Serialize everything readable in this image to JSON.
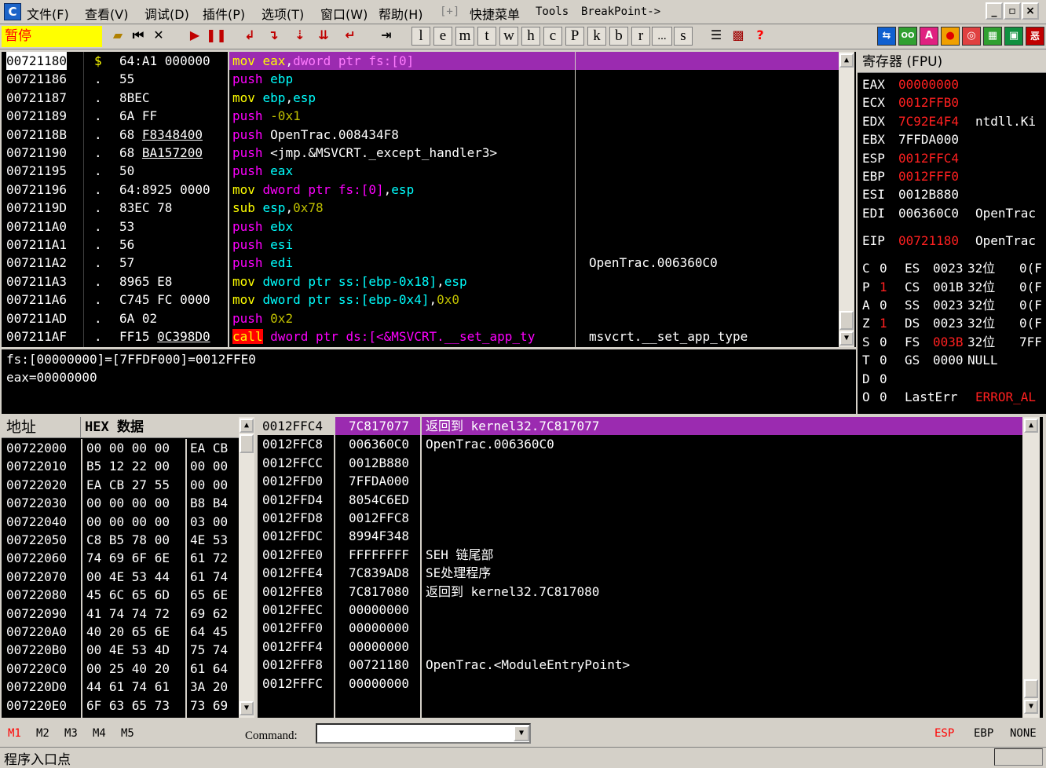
{
  "menubar": {
    "app_icon": "C",
    "items": [
      "文件(F)",
      "查看(V)",
      "调试(D)",
      "插件(P)",
      "选项(T)",
      "窗口(W)",
      "帮助(H)",
      "[+]",
      "快捷菜单",
      "Tools",
      "BreakPoint->"
    ],
    "window_buttons": [
      "_",
      "▫",
      "×"
    ]
  },
  "toolbar": {
    "status": "暂停",
    "letters": [
      "l",
      "e",
      "m",
      "t",
      "w",
      "h",
      "c",
      "P",
      "k",
      "b",
      "r",
      "...",
      "s"
    ],
    "help": "?",
    "right_icons": [
      "⇆",
      "OO",
      "A",
      "●",
      "◎",
      "▦",
      "▣",
      "恶"
    ]
  },
  "cpu": {
    "rows": [
      {
        "addr": "00721180",
        "mark": "$",
        "hex": "64:A1 000000",
        "dis": [
          [
            "mnem-mg",
            "mov "
          ],
          [
            "cy",
            "eax"
          ],
          [
            "wh",
            ","
          ],
          [
            "mg",
            "dword ptr fs:[0]"
          ]
        ],
        "comment": ""
      },
      {
        "addr": "00721186",
        "mark": ".",
        "hex": "55",
        "dis": [
          [
            "mg",
            "push "
          ],
          [
            "cy",
            "ebp"
          ]
        ],
        "comment": ""
      },
      {
        "addr": "00721187",
        "mark": ".",
        "hex": "8BEC",
        "dis": [
          [
            "yl",
            "mov "
          ],
          [
            "cy",
            "ebp"
          ],
          [
            "wh",
            ","
          ],
          [
            "cy",
            "esp"
          ]
        ],
        "comment": ""
      },
      {
        "addr": "00721189",
        "mark": ".",
        "hex": "6A FF",
        "dis": [
          [
            "mg",
            "push "
          ],
          [
            "ol",
            "-0x1"
          ]
        ],
        "comment": ""
      },
      {
        "addr": "0072118B",
        "mark": ".",
        "hex": "68 F8348400",
        "dis": [
          [
            "mg",
            "push "
          ],
          [
            "wh",
            "OpenTrac.008434F8"
          ]
        ],
        "comment": ""
      },
      {
        "addr": "00721190",
        "mark": ".",
        "hex": "68 BA157200",
        "dis": [
          [
            "mg",
            "push "
          ],
          [
            "wh",
            "<jmp.&MSVCRT._except_handler3>"
          ]
        ],
        "comment": ""
      },
      {
        "addr": "00721195",
        "mark": ".",
        "hex": "50",
        "dis": [
          [
            "mg",
            "push "
          ],
          [
            "cy",
            "eax"
          ]
        ],
        "comment": ""
      },
      {
        "addr": "00721196",
        "mark": ".",
        "hex": "64:8925 0000",
        "dis": [
          [
            "yl",
            "mov "
          ],
          [
            "mg",
            "dword ptr fs:[0]"
          ],
          [
            "wh",
            ","
          ],
          [
            "cy",
            "esp"
          ]
        ],
        "comment": ""
      },
      {
        "addr": "0072119D",
        "mark": ".",
        "hex": "83EC 78",
        "dis": [
          [
            "yl",
            "sub "
          ],
          [
            "cy",
            "esp"
          ],
          [
            "wh",
            ","
          ],
          [
            "ol",
            "0x78"
          ]
        ],
        "comment": ""
      },
      {
        "addr": "007211A0",
        "mark": ".",
        "hex": "53",
        "dis": [
          [
            "mg",
            "push "
          ],
          [
            "cy",
            "ebx"
          ]
        ],
        "comment": ""
      },
      {
        "addr": "007211A1",
        "mark": ".",
        "hex": "56",
        "dis": [
          [
            "mg",
            "push "
          ],
          [
            "cy",
            "esi"
          ]
        ],
        "comment": ""
      },
      {
        "addr": "007211A2",
        "mark": ".",
        "hex": "57",
        "dis": [
          [
            "mg",
            "push "
          ],
          [
            "cy",
            "edi"
          ]
        ],
        "comment": "OpenTrac.006360C0"
      },
      {
        "addr": "007211A3",
        "mark": ".",
        "hex": "8965 E8",
        "dis": [
          [
            "yl",
            "mov "
          ],
          [
            "cy",
            "dword ptr ss:[ebp-0x18]"
          ],
          [
            "wh",
            ","
          ],
          [
            "cy",
            "esp"
          ]
        ],
        "comment": ""
      },
      {
        "addr": "007211A6",
        "mark": ".",
        "hex": "C745 FC 0000",
        "dis": [
          [
            "yl",
            "mov "
          ],
          [
            "cy",
            "dword ptr ss:[ebp-0x4]"
          ],
          [
            "wh",
            ","
          ],
          [
            "ol",
            "0x0"
          ]
        ],
        "comment": ""
      },
      {
        "addr": "007211AD",
        "mark": ".",
        "hex": "6A 02",
        "dis": [
          [
            "mg",
            "push "
          ],
          [
            "ol",
            "0x2"
          ]
        ],
        "comment": ""
      },
      {
        "addr": "007211AF",
        "mark": ".",
        "hex": "FF15 0C398D0",
        "dis": [
          [
            "call",
            "call"
          ],
          [
            "wh",
            " "
          ],
          [
            "mg",
            "dword ptr ds:[<&MSVCRT.__set_app_ty"
          ]
        ],
        "comment": "msvcrt.__set_app_type"
      }
    ]
  },
  "info": {
    "lines": [
      "fs:[00000000]=[7FFDF000]=0012FFE0",
      "eax=00000000"
    ]
  },
  "registers": {
    "title": "寄存器 (FPU)",
    "regs": [
      {
        "name": "EAX",
        "val": "00000000",
        "red": true,
        "extra": ""
      },
      {
        "name": "ECX",
        "val": "0012FFB0",
        "red": true,
        "extra": ""
      },
      {
        "name": "EDX",
        "val": "7C92E4F4",
        "red": true,
        "extra": "ntdll.Ki"
      },
      {
        "name": "EBX",
        "val": "7FFDA000",
        "red": false,
        "extra": ""
      },
      {
        "name": "ESP",
        "val": "0012FFC4",
        "red": true,
        "extra": ""
      },
      {
        "name": "EBP",
        "val": "0012FFF0",
        "red": true,
        "extra": ""
      },
      {
        "name": "ESI",
        "val": "0012B880",
        "red": false,
        "extra": ""
      },
      {
        "name": "EDI",
        "val": "006360C0",
        "red": false,
        "extra": "OpenTrac"
      }
    ],
    "eip": {
      "name": "EIP",
      "val": "00721180",
      "extra": "OpenTrac"
    },
    "flags": [
      {
        "f": "C",
        "v": "0",
        "red": false,
        "seg": "ES",
        "sv": "0023",
        "red2": false,
        "bits": "32位",
        "rest": "0(F"
      },
      {
        "f": "P",
        "v": "1",
        "red": true,
        "seg": "CS",
        "sv": "001B",
        "red2": false,
        "bits": "32位",
        "rest": "0(F"
      },
      {
        "f": "A",
        "v": "0",
        "red": false,
        "seg": "SS",
        "sv": "0023",
        "red2": false,
        "bits": "32位",
        "rest": "0(F"
      },
      {
        "f": "Z",
        "v": "1",
        "red": true,
        "seg": "DS",
        "sv": "0023",
        "red2": false,
        "bits": "32位",
        "rest": "0(F"
      },
      {
        "f": "S",
        "v": "0",
        "red": false,
        "seg": "FS",
        "sv": "003B",
        "red2": true,
        "bits": "32位",
        "rest": "7FF"
      },
      {
        "f": "T",
        "v": "0",
        "red": false,
        "seg": "GS",
        "sv": "0000",
        "red2": false,
        "bits": "NULL",
        "rest": ""
      },
      {
        "f": "D",
        "v": "0",
        "red": false,
        "seg": "",
        "sv": "",
        "red2": false,
        "bits": "",
        "rest": ""
      },
      {
        "f": "O",
        "v": "0",
        "red": false,
        "seg": "LastErr",
        "sv": "ERROR_AL",
        "red2": true,
        "bits": "",
        "rest": ""
      }
    ]
  },
  "dump": {
    "col_addr": "地址",
    "col_hex": "HEX 数据",
    "rows": [
      {
        "addr": "00722000",
        "g1": "00 00 00 00",
        "g2": "EA CB"
      },
      {
        "addr": "00722010",
        "g1": "B5 12 22 00",
        "g2": "00 00"
      },
      {
        "addr": "00722020",
        "g1": "EA CB 27 55",
        "g2": "00 00"
      },
      {
        "addr": "00722030",
        "g1": "00 00 00 00",
        "g2": "B8 B4"
      },
      {
        "addr": "00722040",
        "g1": "00 00 00 00",
        "g2": "03 00"
      },
      {
        "addr": "00722050",
        "g1": "C8 B5 78 00",
        "g2": "4E 53"
      },
      {
        "addr": "00722060",
        "g1": "74 69 6F 6E",
        "g2": "61 72"
      },
      {
        "addr": "00722070",
        "g1": "00 4E 53 44",
        "g2": "61 74"
      },
      {
        "addr": "00722080",
        "g1": "45 6C 65 6D",
        "g2": "65 6E"
      },
      {
        "addr": "00722090",
        "g1": "41 74 74 72",
        "g2": "69 62"
      },
      {
        "addr": "007220A0",
        "g1": "40 20 65 6E",
        "g2": "64 45"
      },
      {
        "addr": "007220B0",
        "g1": "00 4E 53 4D",
        "g2": "75 74"
      },
      {
        "addr": "007220C0",
        "g1": "00 25 40 20",
        "g2": "61 64"
      },
      {
        "addr": "007220D0",
        "g1": "44 61 74 61",
        "g2": "3A 20"
      },
      {
        "addr": "007220E0",
        "g1": "6F 63 65 73",
        "g2": "73 69"
      }
    ]
  },
  "stack": {
    "rows": [
      {
        "addr": "0012FFC4",
        "val": "7C817077",
        "comment": "返回到 kernel32.7C817077",
        "selected": true
      },
      {
        "addr": "0012FFC8",
        "val": "006360C0",
        "comment": "OpenTrac.006360C0",
        "selected": false
      },
      {
        "addr": "0012FFCC",
        "val": "0012B880",
        "comment": "",
        "selected": false
      },
      {
        "addr": "0012FFD0",
        "val": "7FFDA000",
        "comment": "",
        "selected": false
      },
      {
        "addr": "0012FFD4",
        "val": "8054C6ED",
        "comment": "",
        "selected": false
      },
      {
        "addr": "0012FFD8",
        "val": "0012FFC8",
        "comment": "",
        "selected": false
      },
      {
        "addr": "0012FFDC",
        "val": "8994F348",
        "comment": "",
        "selected": false
      },
      {
        "addr": "0012FFE0",
        "val": "FFFFFFFF",
        "comment": "SEH 链尾部",
        "selected": false
      },
      {
        "addr": "0012FFE4",
        "val": "7C839AD8",
        "comment": "SE处理程序",
        "selected": false
      },
      {
        "addr": "0012FFE8",
        "val": "7C817080",
        "comment": "返回到 kernel32.7C817080",
        "selected": false
      },
      {
        "addr": "0012FFEC",
        "val": "00000000",
        "comment": "",
        "selected": false
      },
      {
        "addr": "0012FFF0",
        "val": "00000000",
        "comment": "",
        "selected": false
      },
      {
        "addr": "0012FFF4",
        "val": "00000000",
        "comment": "",
        "selected": false
      },
      {
        "addr": "0012FFF8",
        "val": "00721180",
        "comment": "OpenTrac.<ModuleEntryPoint>",
        "selected": false
      },
      {
        "addr": "0012FFFC",
        "val": "00000000",
        "comment": "",
        "selected": false
      }
    ]
  },
  "bottombar": {
    "marks": [
      "M1",
      "M2",
      "M3",
      "M4",
      "M5"
    ],
    "command_label": "Command:",
    "command_value": "",
    "right": [
      "ESP",
      "EBP",
      "NONE"
    ],
    "status": "程序入口点"
  },
  "colors": {
    "selection": "#9b2bb0",
    "accent_red": "#ff0000",
    "pause_bg": "#ffff00"
  }
}
